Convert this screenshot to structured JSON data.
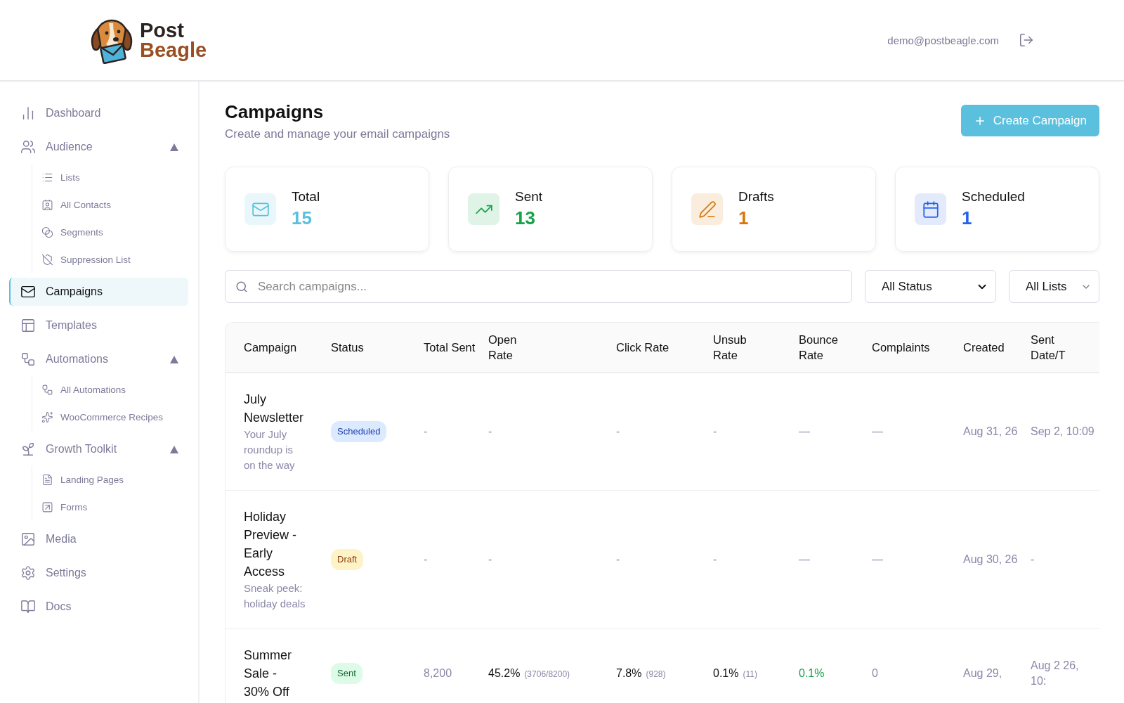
{
  "header": {
    "logo": {
      "line1": "Post",
      "line2": "Beagle"
    },
    "user_email": "demo@postbeagle.com"
  },
  "sidebar": {
    "items": [
      {
        "label": "Dashboard",
        "selected": false
      },
      {
        "label": "Audience",
        "selected": false,
        "expanded": true,
        "children": [
          {
            "label": "Lists",
            "selected": false
          },
          {
            "label": "All Contacts",
            "selected": false
          },
          {
            "label": "Segments",
            "selected": false
          },
          {
            "label": "Suppression List",
            "selected": false
          }
        ]
      },
      {
        "label": "Campaigns",
        "selected": true
      },
      {
        "label": "Templates",
        "selected": false
      },
      {
        "label": "Automations",
        "selected": false,
        "expanded": true,
        "children": [
          {
            "label": "All Automations",
            "selected": false
          },
          {
            "label": "WooCommerce Recipes",
            "selected": false
          }
        ]
      },
      {
        "label": "Growth Toolkit",
        "selected": false,
        "expanded": true,
        "children": [
          {
            "label": "Landing Pages",
            "selected": false
          },
          {
            "label": "Forms",
            "selected": false
          }
        ]
      },
      {
        "label": "Media",
        "selected": false
      },
      {
        "label": "Settings",
        "selected": false
      },
      {
        "label": "Docs",
        "selected": false
      }
    ]
  },
  "page": {
    "title": "Campaigns",
    "subtitle": "Create and manage your email campaigns",
    "create_button": "Create Campaign"
  },
  "stats": [
    {
      "label": "Total",
      "value": "15",
      "color": "#5bc0de"
    },
    {
      "label": "Sent",
      "value": "13",
      "color": "#16a34a"
    },
    {
      "label": "Drafts",
      "value": "1",
      "color": "#d97706"
    },
    {
      "label": "Scheduled",
      "value": "1",
      "color": "#2563eb"
    }
  ],
  "filters": {
    "search": {
      "placeholder": "Search campaigns..."
    },
    "status_select": "All Status",
    "list_select": "All Lists"
  },
  "table": {
    "columns": [
      "Campaign",
      "Status",
      "Total Sent",
      "Open Rate",
      "Click Rate",
      "Unsub Rate",
      "Bounce Rate",
      "Complaints",
      "Created",
      "Sent Date/T"
    ],
    "rows": [
      {
        "cells": [
          {
            "text": "July Newsletter",
            "detail": "Your July roundup is on the way",
            "kind": "campaign"
          },
          {
            "text": "Scheduled",
            "kind": "scheduled"
          },
          {
            "text": "-",
            "kind": "muted"
          },
          {
            "text": "-",
            "kind": "muted"
          },
          {
            "text": "-",
            "kind": "muted"
          },
          {
            "text": "-",
            "kind": "muted"
          },
          {
            "text": "—",
            "kind": "muted"
          },
          {
            "text": "—",
            "kind": "muted"
          },
          {
            "text": "Aug 31, 26",
            "kind": "muted"
          },
          {
            "text": "Sep 2, 10:09",
            "kind": "muted"
          }
        ]
      },
      {
        "cells": [
          {
            "text": "Holiday Preview - Early Access",
            "detail": "Sneak peek: holiday deals",
            "kind": "campaign"
          },
          {
            "text": "Draft",
            "kind": "draft"
          },
          {
            "text": "-",
            "kind": "muted"
          },
          {
            "text": "-",
            "kind": "muted"
          },
          {
            "text": "-",
            "kind": "muted"
          },
          {
            "text": "-",
            "kind": "muted"
          },
          {
            "text": "—",
            "kind": "muted"
          },
          {
            "text": "—",
            "kind": "muted"
          },
          {
            "text": "Aug 30, 26",
            "kind": "muted"
          },
          {
            "text": "-",
            "kind": "muted"
          }
        ]
      },
      {
        "cells": [
          {
            "text": "Summer Sale - 30% Off",
            "kind": "campaign"
          },
          {
            "text": "Sent",
            "kind": "sent"
          },
          {
            "text": "8,200",
            "kind": "muted"
          },
          {
            "text": "45.2%",
            "detail": "(3706/8200)",
            "kind": "plain"
          },
          {
            "text": "7.8%",
            "detail": "(928)",
            "kind": "plain"
          },
          {
            "text": "0.1%",
            "detail": "(11)",
            "kind": "plain"
          },
          {
            "text": "0.1%",
            "kind": "good"
          },
          {
            "text": "0",
            "kind": "muted"
          },
          {
            "text": "Aug 29,",
            "kind": "muted"
          },
          {
            "text": "Aug 2 26, 10:",
            "kind": "muted"
          }
        ]
      }
    ]
  }
}
